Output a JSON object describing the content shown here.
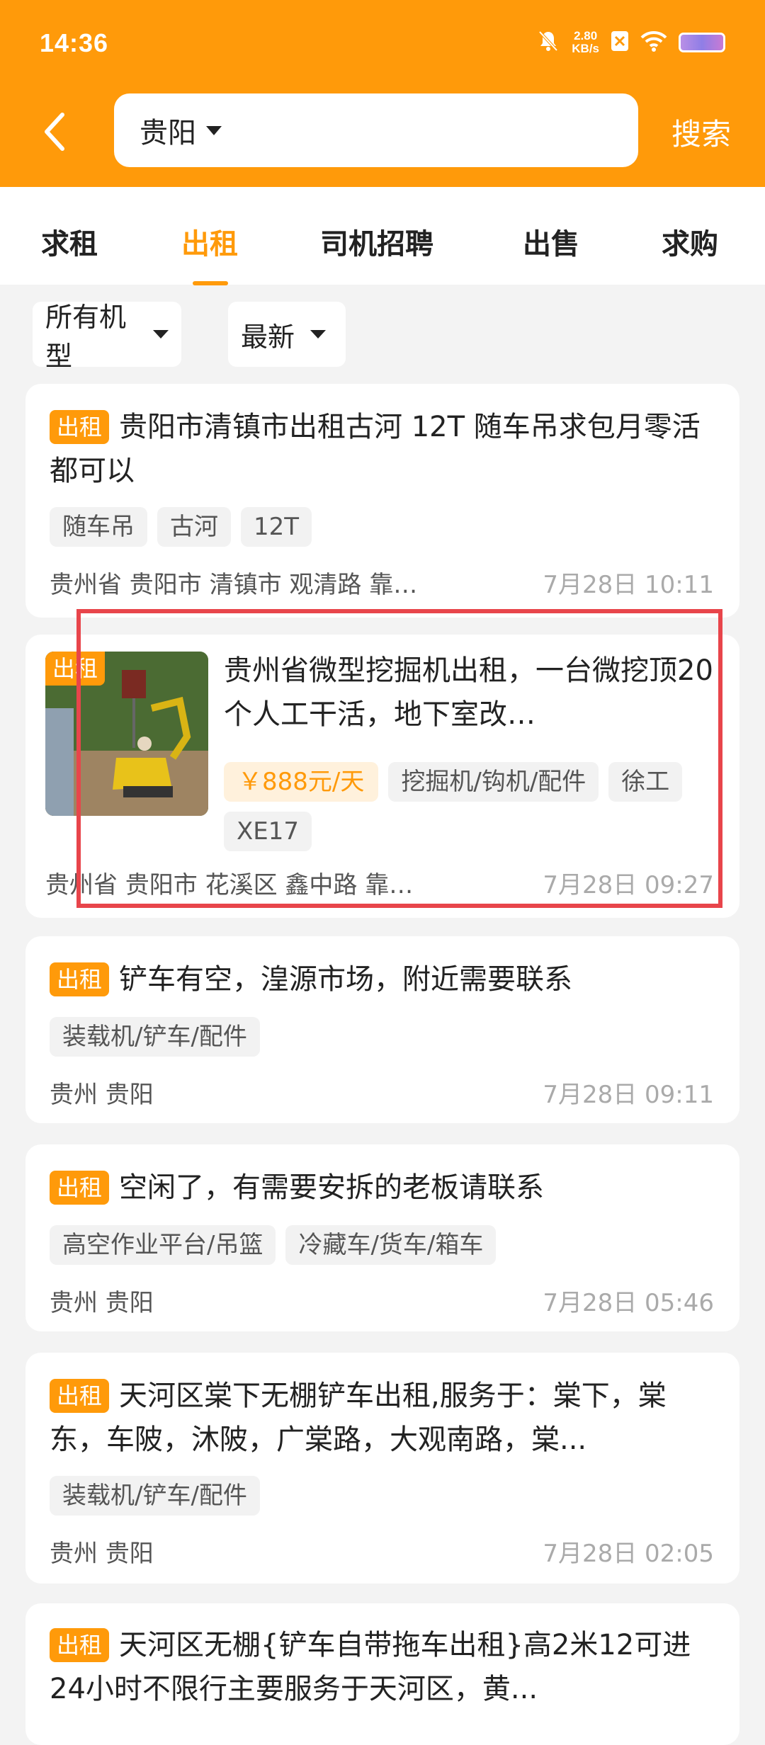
{
  "status_bar": {
    "time": "14:36",
    "net_speed_value": "2.80",
    "net_speed_unit": "KB/s"
  },
  "header": {
    "city": "贵阳",
    "search_label": "搜索"
  },
  "tabs": [
    {
      "label": "求租"
    },
    {
      "label": "出租",
      "active": true
    },
    {
      "label": "司机招聘"
    },
    {
      "label": "出售"
    },
    {
      "label": "求购"
    }
  ],
  "filters": {
    "type": "所有机型",
    "sort": "最新"
  },
  "badge": "出租",
  "listings": [
    {
      "title": "贵阳市清镇市出租古河 12T 随车吊求包月零活都可以",
      "tags": [
        "随车吊",
        "古河",
        "12T"
      ],
      "location": "贵州省 贵阳市 清镇市 观清路 靠…",
      "time": "7月28日 10:11"
    },
    {
      "title": "贵州省微型挖掘机出租，一台微挖顶20个人工干活，地下室改…",
      "price": "￥888元/天",
      "tags": [
        "挖掘机/钩机/配件",
        "徐工",
        "XE17"
      ],
      "location": "贵州省 贵阳市 花溪区 鑫中路 靠…",
      "time": "7月28日 09:27"
    },
    {
      "title": "铲车有空，湟源市场，附近需要联系",
      "tags": [
        "装载机/铲车/配件"
      ],
      "location": "贵州 贵阳",
      "time": "7月28日 09:11"
    },
    {
      "title": "空闲了，有需要安拆的老板请联系",
      "tags": [
        "高空作业平台/吊篮",
        "冷藏车/货车/箱车"
      ],
      "location": "贵州 贵阳",
      "time": "7月28日 05:46"
    },
    {
      "title": "天河区棠下无棚铲车出租,服务于：棠下，棠东，车陂，沐陂，广棠路，大观南路，棠...",
      "tags": [
        "装载机/铲车/配件"
      ],
      "location": "贵州 贵阳",
      "time": "7月28日 02:05"
    },
    {
      "title": "天河区无棚{铲车自带拖车出租}高2米12可进24小时不限行主要服务于天河区，黄..."
    }
  ],
  "colors": {
    "accent": "#ff9a0a",
    "highlight": "#e8454b",
    "background": "#f3f3f3"
  }
}
